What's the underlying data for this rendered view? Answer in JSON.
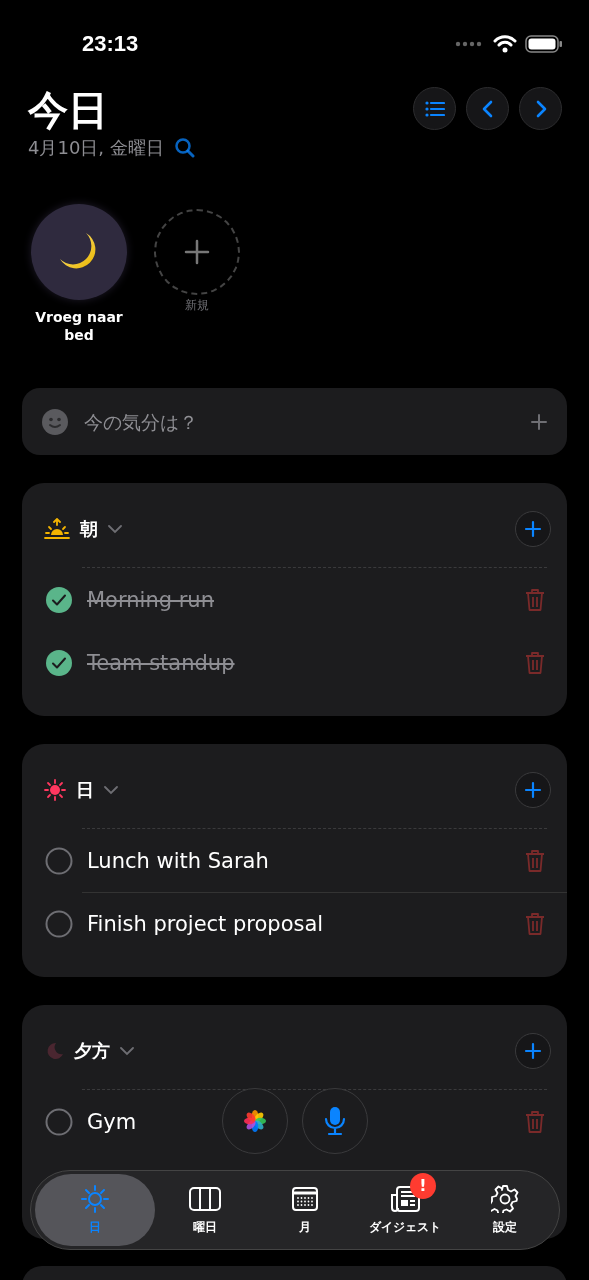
{
  "status_bar": {
    "time": "23:13"
  },
  "header": {
    "title": "今日",
    "date": "4月10日, 金曜日"
  },
  "habits": [
    {
      "kind": "habit",
      "label": "Vroeg naar bed"
    },
    {
      "kind": "new",
      "label": "新規"
    }
  ],
  "mood": {
    "placeholder": "今の気分は？"
  },
  "sections": [
    {
      "kind": "sunrise",
      "title": "朝",
      "tasks": [
        {
          "label": "Morning run",
          "done": true
        },
        {
          "label": "Team standup",
          "done": true
        }
      ]
    },
    {
      "kind": "sun",
      "title": "日",
      "tasks": [
        {
          "label": "Lunch with Sarah",
          "done": false
        },
        {
          "label": "Finish project proposal",
          "done": false
        }
      ]
    },
    {
      "kind": "moon",
      "title": "夕方",
      "tasks": [
        {
          "label": "Gym",
          "done": false
        }
      ]
    }
  ],
  "tab_bar": [
    {
      "kind": "day",
      "label": "日",
      "selected": true,
      "badge": false
    },
    {
      "kind": "week",
      "label": "曜日",
      "selected": false,
      "badge": false
    },
    {
      "kind": "month",
      "label": "月",
      "selected": false,
      "badge": false
    },
    {
      "kind": "digest",
      "label": "ダイジェスト",
      "selected": false,
      "badge": true,
      "badge_text": "!"
    },
    {
      "kind": "settings",
      "label": "設定",
      "selected": false,
      "badge": false
    }
  ]
}
